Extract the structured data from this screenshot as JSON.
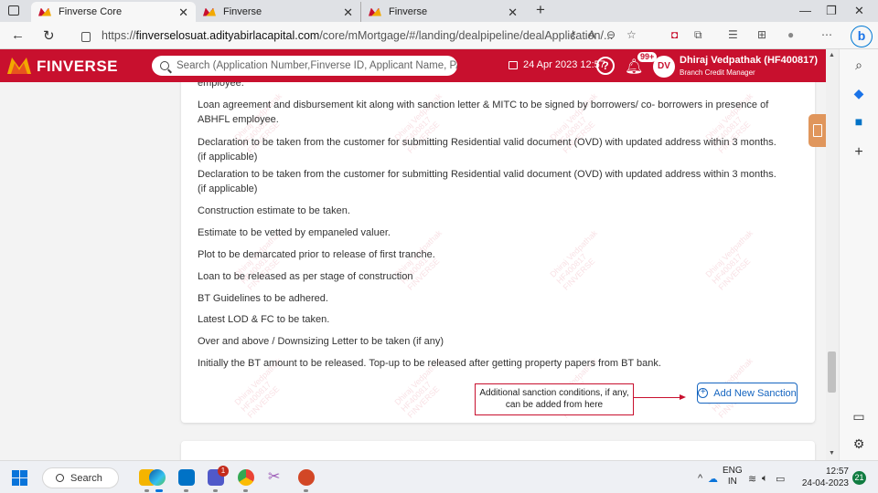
{
  "browser": {
    "tabs": [
      {
        "title": "Finverse Core",
        "active": true
      },
      {
        "title": "Finverse",
        "active": false
      },
      {
        "title": "Finverse",
        "active": false
      }
    ],
    "url_prefix": "https://",
    "url_host": "finverselosuat.adityabirlacapital.com",
    "url_path": "/core/mMortgage/#/landing/dealpipeline/dealApplication/..."
  },
  "app": {
    "brand": "FINVERSE",
    "brand_colors": {
      "primary": "#c8102e",
      "accent": "#f2a900"
    },
    "search_placeholder": "Search (Application Number,Finverse ID, Applicant Name, PAN Number)",
    "date": "24 Apr 2023 12:57",
    "notification_badge": "99+",
    "user": {
      "initials": "DV",
      "name": "Dhiraj Vedpathak (HF400817)",
      "role": "Branch Credit Manager"
    }
  },
  "conditions": [
    "employee.",
    "Loan agreement and disbursement kit along with sanction letter & MITC to be signed by borrowers/ co- borrowers in presence of ABHFL employee.",
    "Declaration to be taken from the customer for submitting Residential valid document (OVD) with updated address within 3 months. (if applicable)",
    "Declaration to be taken from the customer for submitting Residential valid document (OVD) with updated address within 3 months. (if applicable)",
    "Construction estimate to be taken.",
    "Estimate to be vetted by empaneled valuer.",
    "Plot to be demarcated prior to release of first tranche.",
    "Loan to be released as per stage of construction",
    "BT Guidelines to be adhered.",
    "Latest LOD & FC to be taken.",
    "Over and above / Downsizing Letter to be taken (if any)",
    "Initially the BT amount to be released. Top-up to be released after getting property papers from BT bank."
  ],
  "callout": "Additional sanction conditions, if any, can be added from here",
  "add_sanction_label": "Add New Sanction",
  "watermark": {
    "line1": "Dhiraj Vedpathak",
    "line2": "HF400817",
    "line3": "FINVERSE"
  },
  "taskbar": {
    "search_label": "Search",
    "teams_badge": "1",
    "lang_line1": "ENG",
    "lang_line2": "IN",
    "time": "12:57",
    "date": "24-04-2023",
    "notification_count": "21"
  }
}
